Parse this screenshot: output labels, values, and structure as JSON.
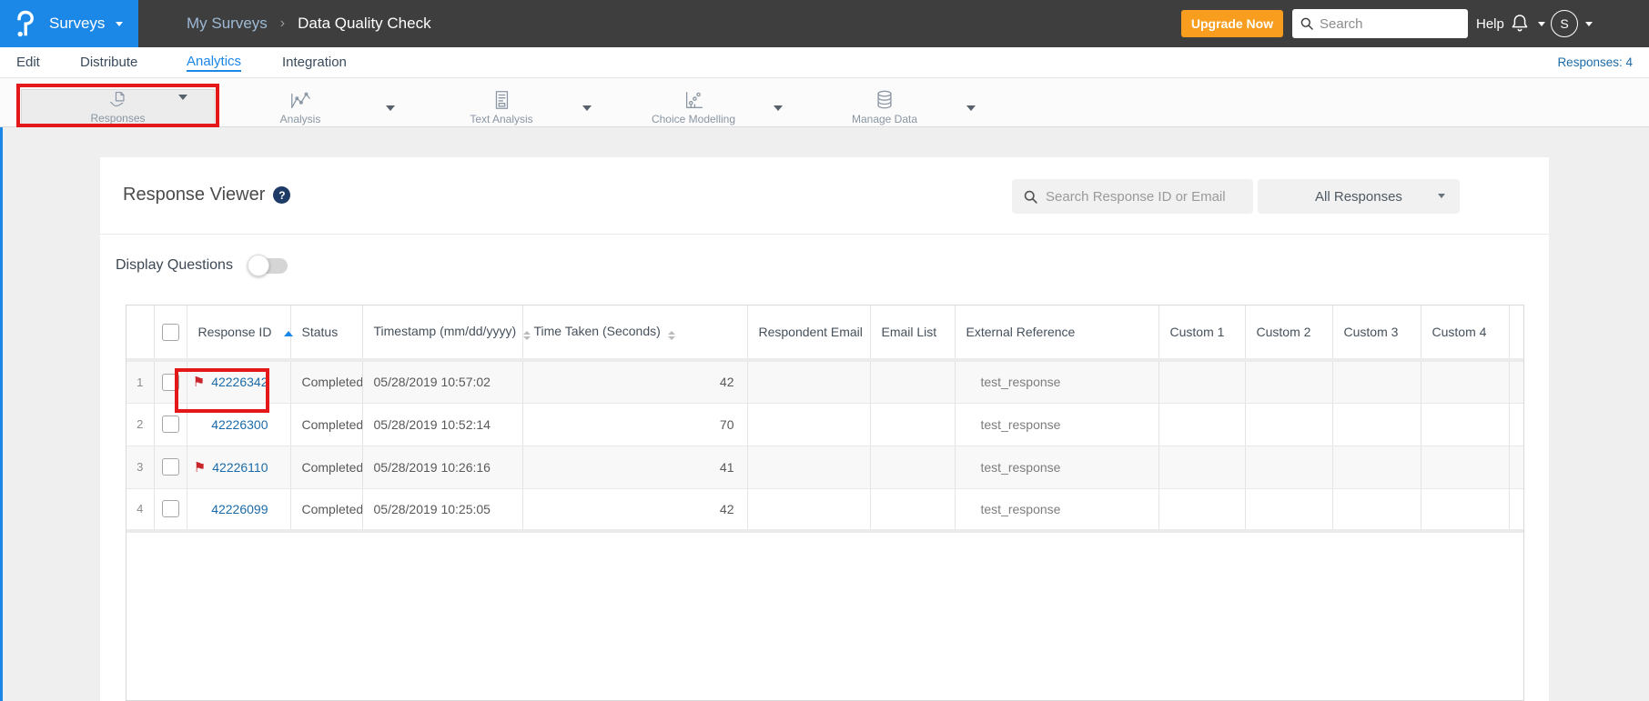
{
  "topbar": {
    "product": "Surveys",
    "breadcrumb": [
      "My Surveys",
      "Data Quality Check"
    ],
    "breadcrumb_separator": "›",
    "upgrade_label": "Upgrade Now",
    "search_placeholder": "Search",
    "help_label": "Help",
    "avatar_initial": "S"
  },
  "nav": {
    "items": [
      "Edit",
      "Distribute",
      "Analytics",
      "Integration"
    ],
    "active": "Analytics",
    "responses_count": "Responses: 4"
  },
  "toolbar": {
    "items": [
      {
        "label": "Responses",
        "selected": true
      },
      {
        "label": "Analysis",
        "selected": false
      },
      {
        "label": "Text Analysis",
        "selected": false
      },
      {
        "label": "Choice Modelling",
        "selected": false
      },
      {
        "label": "Manage Data",
        "selected": false
      }
    ]
  },
  "viewer": {
    "title": "Response Viewer",
    "help_glyph": "?",
    "search_placeholder": "Search Response ID or Email",
    "filter_selected": "All Responses",
    "display_questions_label": "Display Questions",
    "display_questions_on": false
  },
  "table": {
    "columns": [
      "",
      "",
      "Response ID",
      "Status",
      "Timestamp (mm/dd/yyyy)",
      "Time Taken (Seconds)",
      "Respondent Email",
      "Email List",
      "External Reference",
      "Custom 1",
      "Custom 2",
      "Custom 3",
      "Custom 4",
      ""
    ],
    "sort": {
      "column": "Response ID",
      "direction": "asc"
    },
    "rows": [
      {
        "num": "1",
        "flagged": true,
        "id": "42226342",
        "status": "Completed",
        "timestamp": "05/28/2019 10:57:02",
        "time_taken": "42",
        "respondent_email": "",
        "email_list": "",
        "external_reference": "test_response",
        "custom1": "",
        "custom2": "",
        "custom3": "",
        "custom4": ""
      },
      {
        "num": "2",
        "flagged": false,
        "id": "42226300",
        "status": "Completed",
        "timestamp": "05/28/2019 10:52:14",
        "time_taken": "70",
        "respondent_email": "",
        "email_list": "",
        "external_reference": "test_response",
        "custom1": "",
        "custom2": "",
        "custom3": "",
        "custom4": ""
      },
      {
        "num": "3",
        "flagged": true,
        "id": "42226110",
        "status": "Completed",
        "timestamp": "05/28/2019 10:26:16",
        "time_taken": "41",
        "respondent_email": "",
        "email_list": "",
        "external_reference": "test_response",
        "custom1": "",
        "custom2": "",
        "custom3": "",
        "custom4": ""
      },
      {
        "num": "4",
        "flagged": false,
        "id": "42226099",
        "status": "Completed",
        "timestamp": "05/28/2019 10:25:05",
        "time_taken": "42",
        "respondent_email": "",
        "email_list": "",
        "external_reference": "test_response",
        "custom1": "",
        "custom2": "",
        "custom3": "",
        "custom4": ""
      }
    ]
  },
  "colors": {
    "accent_blue": "#1b87e6",
    "upgrade_orange": "#f89d1d",
    "annotation_red": "#e41818",
    "flag_red": "#c9252b",
    "link_blue": "#1c6ba8",
    "topbar_dark": "#3e3e3e"
  }
}
